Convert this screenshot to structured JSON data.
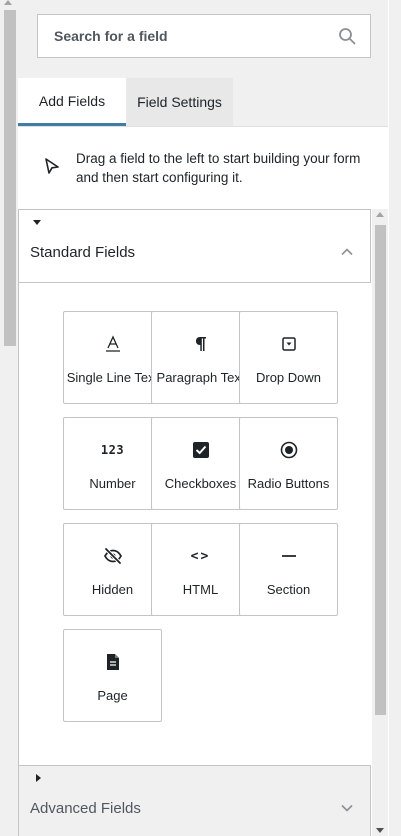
{
  "search": {
    "placeholder": "Search for a field"
  },
  "tabs": [
    {
      "label": "Add Fields",
      "active": true
    },
    {
      "label": "Field Settings",
      "active": false
    }
  ],
  "help_text": "Drag a field to the left to start building your form and then start configuring it.",
  "standard_section": {
    "title": "Standard Fields",
    "expanded": true
  },
  "advanced_section": {
    "title": "Advanced Fields",
    "expanded": false
  },
  "fields": [
    {
      "label": "Single Line Text",
      "icon": "text-line-icon"
    },
    {
      "label": "Paragraph Text",
      "icon": "pilcrow-icon"
    },
    {
      "label": "Drop Down",
      "icon": "dropdown-icon"
    },
    {
      "label": "Number",
      "icon": "number-icon",
      "glyph": "123"
    },
    {
      "label": "Checkboxes",
      "icon": "checkbox-icon"
    },
    {
      "label": "Radio Buttons",
      "icon": "radio-icon"
    },
    {
      "label": "Hidden",
      "icon": "eye-off-icon"
    },
    {
      "label": "HTML",
      "icon": "code-icon",
      "glyph": "<>"
    },
    {
      "label": "Section",
      "icon": "section-dash-icon"
    },
    {
      "label": "Page",
      "icon": "page-icon"
    }
  ],
  "colors": {
    "accent": "#3e7da6",
    "icon": "#1d2327",
    "border": "#c3c4c7"
  }
}
